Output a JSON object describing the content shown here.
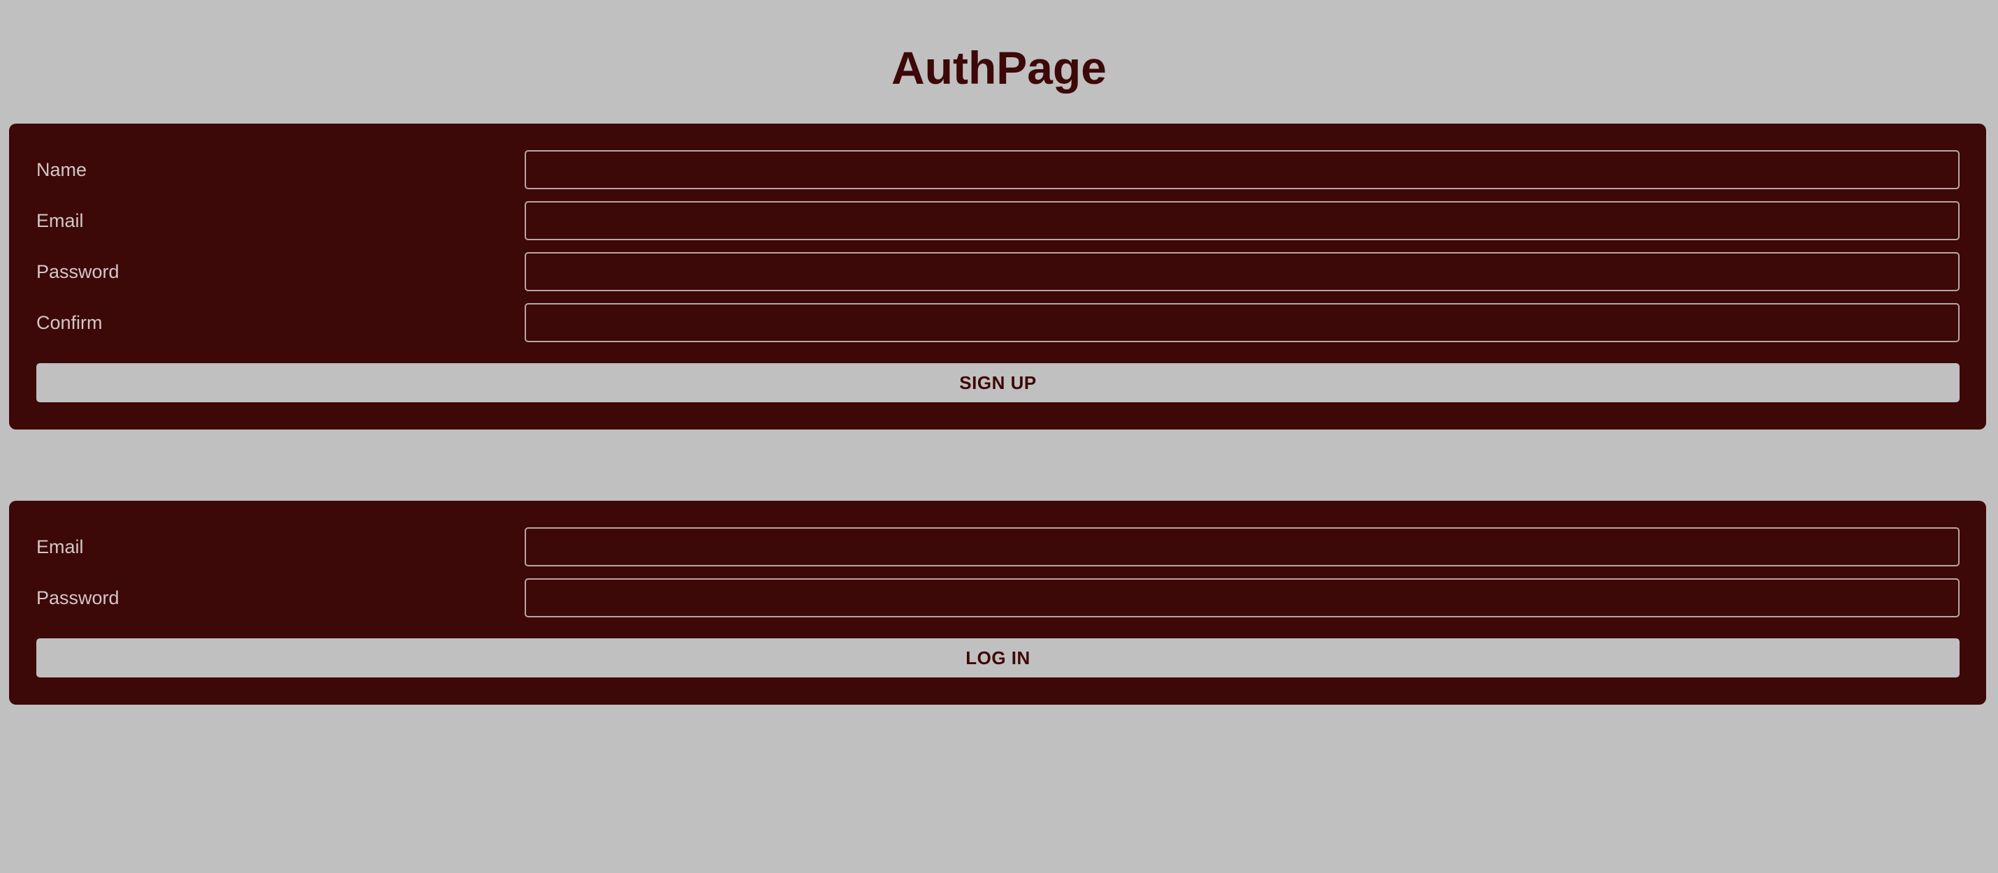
{
  "page": {
    "title": "AuthPage"
  },
  "colors": {
    "background": "#c0c0c0",
    "panel": "#3d0808",
    "label_text": "#d2c7c7",
    "input_border": "#b9a6a6",
    "button_background": "#c0c0c0",
    "button_text": "#3d0808"
  },
  "signup": {
    "fields": [
      {
        "label": "Name",
        "value": "",
        "placeholder": ""
      },
      {
        "label": "Email",
        "value": "",
        "placeholder": ""
      },
      {
        "label": "Password",
        "value": "",
        "placeholder": ""
      },
      {
        "label": "Confirm",
        "value": "",
        "placeholder": ""
      }
    ],
    "button_label": "SIGN UP"
  },
  "login": {
    "fields": [
      {
        "label": "Email",
        "value": "",
        "placeholder": ""
      },
      {
        "label": "Password",
        "value": "",
        "placeholder": ""
      }
    ],
    "button_label": "LOG IN"
  }
}
